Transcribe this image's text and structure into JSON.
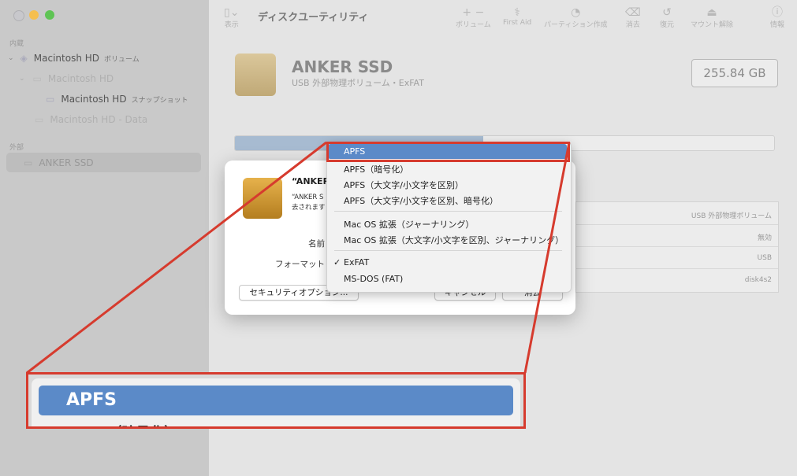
{
  "window": {
    "title": "ディスクユーティリティ"
  },
  "toolbar": {
    "view_label": "表示",
    "volume_label": "ボリューム",
    "firstaid_label": "First Aid",
    "partition_label": "パーティション作成",
    "erase_label": "消去",
    "restore_label": "復元",
    "unmount_label": "マウント解除",
    "info_label": "情報"
  },
  "sidebar": {
    "internal_header": "内蔵",
    "external_header": "外部",
    "items": [
      {
        "label": "Macintosh HD",
        "sub": "ボリューム"
      },
      {
        "label": "Macintosh HD"
      },
      {
        "label": "Macintosh HD",
        "sub": "スナップショット"
      },
      {
        "label": "Macintosh HD - Data"
      },
      {
        "label": "ANKER SSD"
      }
    ]
  },
  "disk": {
    "name": "ANKER SSD",
    "subtitle": "USB 外部物理ボリューム・ExFAT",
    "capacity": "255.84 GB",
    "used_fraction": 0.46
  },
  "info_rows": [
    "USB 外部物理ボリューム",
    "無効",
    "USB",
    "disk4s2"
  ],
  "dialog": {
    "title": "“ANKER",
    "text_line1": "“ANKER S",
    "text_line2": "去されます",
    "name_label": "名前",
    "format_label": "フォーマット",
    "security_button": "セキュリティオプション...",
    "cancel_button": "キャンセル",
    "erase_button": "消去"
  },
  "format_menu": {
    "items": [
      "APFS",
      "APFS（暗号化）",
      "APFS（大文字/小文字を区別）",
      "APFS（大文字/小文字を区別、暗号化）",
      "Mac OS 拡張（ジャーナリング）",
      "Mac OS 拡張（大文字/小文字を区別、ジャーナリング）",
      "ExFAT",
      "MS-DOS (FAT)"
    ],
    "highlighted": "APFS",
    "checked": "ExFAT",
    "check_mark": "✓"
  },
  "zoom": {
    "item": "APFS",
    "next_item": "APFS（暗号化）"
  },
  "colors": {
    "highlight": "#5b8ac8",
    "callout": "#d63b2e"
  }
}
